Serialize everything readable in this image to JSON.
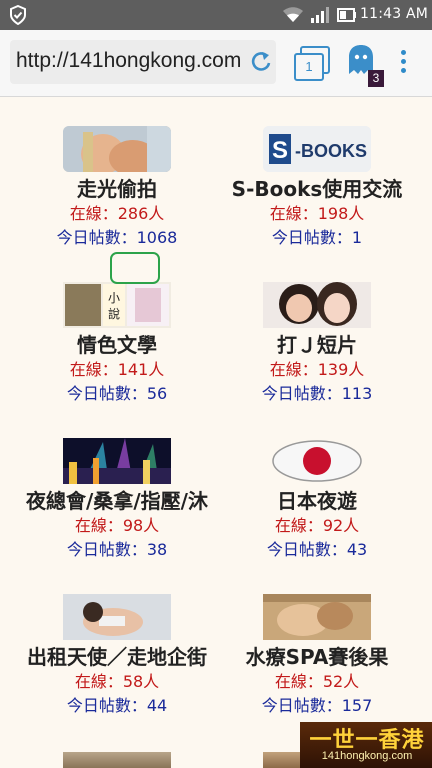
{
  "status_bar": {
    "time": "11:43 AM",
    "icons": [
      "shield-icon",
      "wifi-icon",
      "signal-icon",
      "battery-icon"
    ]
  },
  "browser": {
    "url": "http://141hongkong.com",
    "tab_count": "1",
    "ghost_badge": "3",
    "accent_color": "#3b8ec9"
  },
  "forums": [
    {
      "title": "走光偷拍",
      "online": "在線：286人",
      "today": "今日帖數：1068",
      "thumb": "photo"
    },
    {
      "title": "S-Books使用交流",
      "online": "在線：198人",
      "today": "今日帖數：1",
      "thumb": "S-BOOKS"
    },
    {
      "title": "情色文學",
      "online": "在線：141人",
      "today": "今日帖數：56",
      "thumb": "小說"
    },
    {
      "title": "打Ｊ短片",
      "online": "在線：139人",
      "today": "今日帖數：113",
      "thumb": "photo"
    },
    {
      "title": "夜總會/桑拿/指壓/沐",
      "online": "在線：98人",
      "today": "今日帖數：38",
      "thumb": "photo"
    },
    {
      "title": "日本夜遊",
      "online": "在線：92人",
      "today": "今日帖數：43",
      "thumb": "japan-flag"
    },
    {
      "title": "出租天使／走地企街",
      "online": "在線：58人",
      "today": "今日帖數：44",
      "thumb": "photo"
    },
    {
      "title": "水療SPA賽後果",
      "online": "在線：52人",
      "today": "今日帖數：157",
      "thumb": "photo"
    }
  ],
  "watermark": {
    "main": "一世一香港",
    "sub": "141hongkong.com"
  }
}
